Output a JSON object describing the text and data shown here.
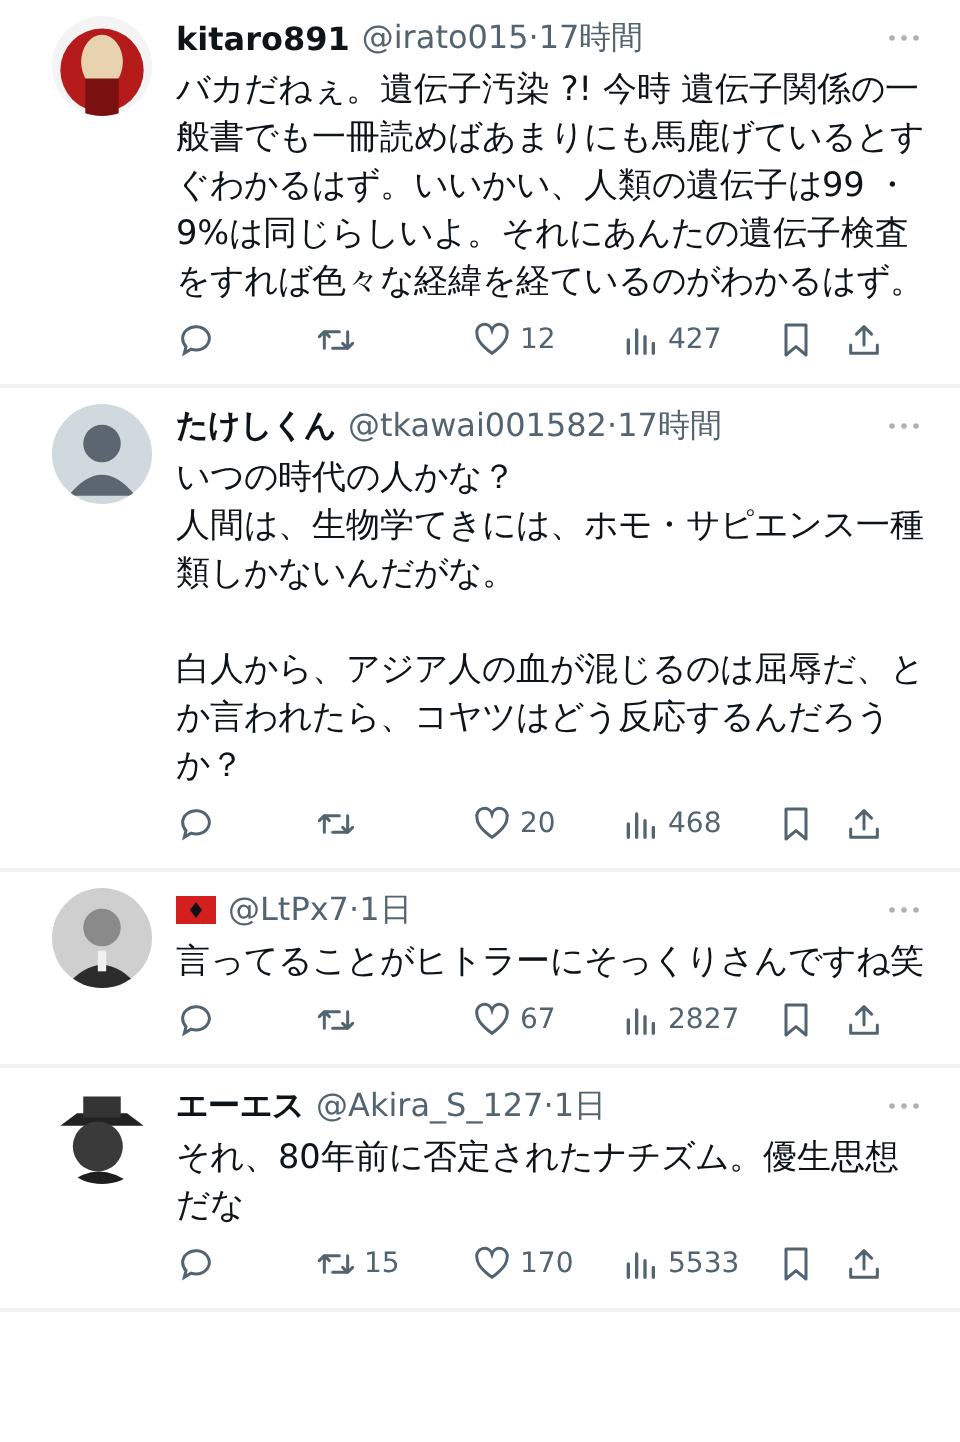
{
  "replies": [
    {
      "avatar": {
        "kind": "picture"
      },
      "name": "kitaro891",
      "meta": "@irato015·17時間",
      "paragraphs": [
        [
          "バカだねぇ。遺伝子汚染 ?! 今時 遺伝子関係の一般書でも一冊読めばあまりにも馬鹿げているとすぐわかるはず。いいかい、人類の遺伝子は99 ・ 9%は同じらしいよ。それにあんたの遺伝子検査をすれば色々な経緯を経ているのがわかるはず。"
        ]
      ],
      "actions": {
        "likes": "12",
        "views": "427"
      }
    },
    {
      "avatar": {
        "kind": "default"
      },
      "name": "たけしくん",
      "meta": "@tkawai001582·17時間",
      "paragraphs": [
        [
          "いつの時代の人かな？",
          "人間は、生物学てきには、ホモ・サピエンス一種類しかないんだがな。"
        ],
        [
          "白人から、アジア人の血が混じるのは屈辱だ、とか言われたら、コヤツはどう反応するんだろうか？"
        ]
      ],
      "actions": {
        "likes": "20",
        "views": "468"
      }
    },
    {
      "avatar": {
        "kind": "picture"
      },
      "flag": true,
      "meta": "@LtPx7·1日",
      "paragraphs": [
        [
          "言ってることがヒトラーにそっくりさんですね笑"
        ]
      ],
      "actions": {
        "likes": "67",
        "views": "2827"
      }
    },
    {
      "avatar": {
        "kind": "picture"
      },
      "name": "エーエス",
      "meta": "@Akira_S_127·1日",
      "paragraphs": [
        [
          "それ、80年前に否定されたナチズム。優生思想だな"
        ]
      ],
      "actions": {
        "retweets": "15",
        "likes": "170",
        "views": "5533"
      }
    }
  ]
}
